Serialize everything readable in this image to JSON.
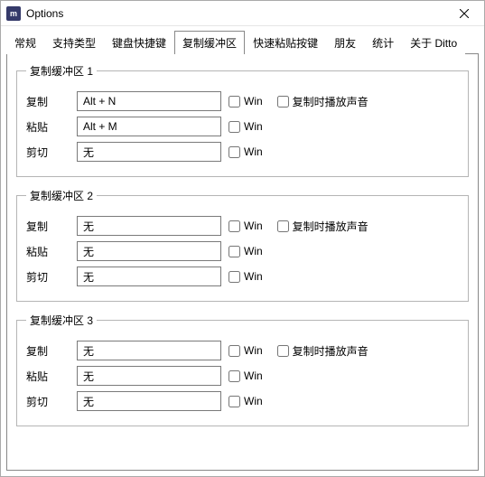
{
  "window": {
    "title": "Options",
    "icon_text": "m"
  },
  "tabs": {
    "items": [
      {
        "label": "常规"
      },
      {
        "label": "支持类型"
      },
      {
        "label": "键盘快捷键"
      },
      {
        "label": "复制缓冲区"
      },
      {
        "label": "快速粘贴按键"
      },
      {
        "label": "朋友"
      },
      {
        "label": "统计"
      },
      {
        "label": "关于 Ditto"
      }
    ],
    "active_index": 3
  },
  "labels": {
    "copy": "复制",
    "paste": "粘贴",
    "cut": "剪切",
    "win": "Win",
    "play_sound": "复制时播放声音",
    "none": "无"
  },
  "groups": [
    {
      "legend": "复制缓冲区 1",
      "copy_value": "Alt + N",
      "paste_value": "Alt + M",
      "cut_value": "无",
      "copy_win": false,
      "paste_win": false,
      "cut_win": false,
      "play_sound": false
    },
    {
      "legend": "复制缓冲区 2",
      "copy_value": "无",
      "paste_value": "无",
      "cut_value": "无",
      "copy_win": false,
      "paste_win": false,
      "cut_win": false,
      "play_sound": false
    },
    {
      "legend": "复制缓冲区 3",
      "copy_value": "无",
      "paste_value": "无",
      "cut_value": "无",
      "copy_win": false,
      "paste_win": false,
      "cut_win": false,
      "play_sound": false
    }
  ]
}
